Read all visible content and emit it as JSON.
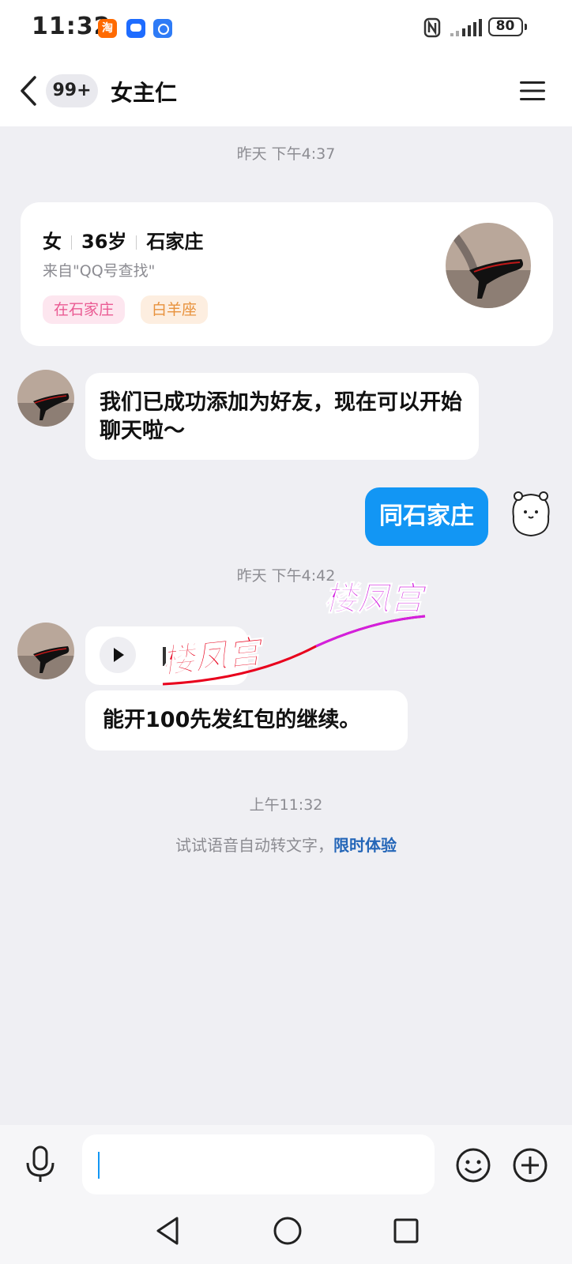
{
  "status_bar": {
    "time": "11:32",
    "app_icons": [
      "taobao-icon",
      "assistant-icon",
      "download-icon"
    ],
    "taobao_glyph": "淘",
    "battery_level": "80"
  },
  "header": {
    "unread_badge": "99+",
    "title": "女主仁"
  },
  "chat": {
    "timestamp_1": "昨天 下午4:37",
    "profile_card": {
      "gender": "女",
      "age": "36岁",
      "city": "石家庄",
      "source": "来自\"QQ号查找\"",
      "tags": [
        "在石家庄",
        "白羊座"
      ]
    },
    "system_message": "我们已成功添加为好友，现在可以开始聊天啦～",
    "my_message": "同石家庄",
    "timestamp_2": "昨天 下午4:42",
    "voice_message": {
      "transcript": "能开100先发红包的继续。"
    },
    "watermark_text": "楼凤宫",
    "timestamp_3": "上午11:32",
    "hint": {
      "text": "试试语音自动转文字，",
      "link": "限时体验"
    }
  },
  "input_bar": {
    "text_value": "",
    "icons": [
      "microphone-icon",
      "emoji-icon",
      "plus-icon"
    ]
  },
  "colors": {
    "accent_blue": "#1296f4",
    "chat_background": "#efeff3",
    "link_blue": "#2466b8",
    "tag_pink": "#ea5b93",
    "tag_orange": "#e8923d",
    "watermark_red": "#e8001c",
    "watermark_magenta": "#d21fe0"
  }
}
